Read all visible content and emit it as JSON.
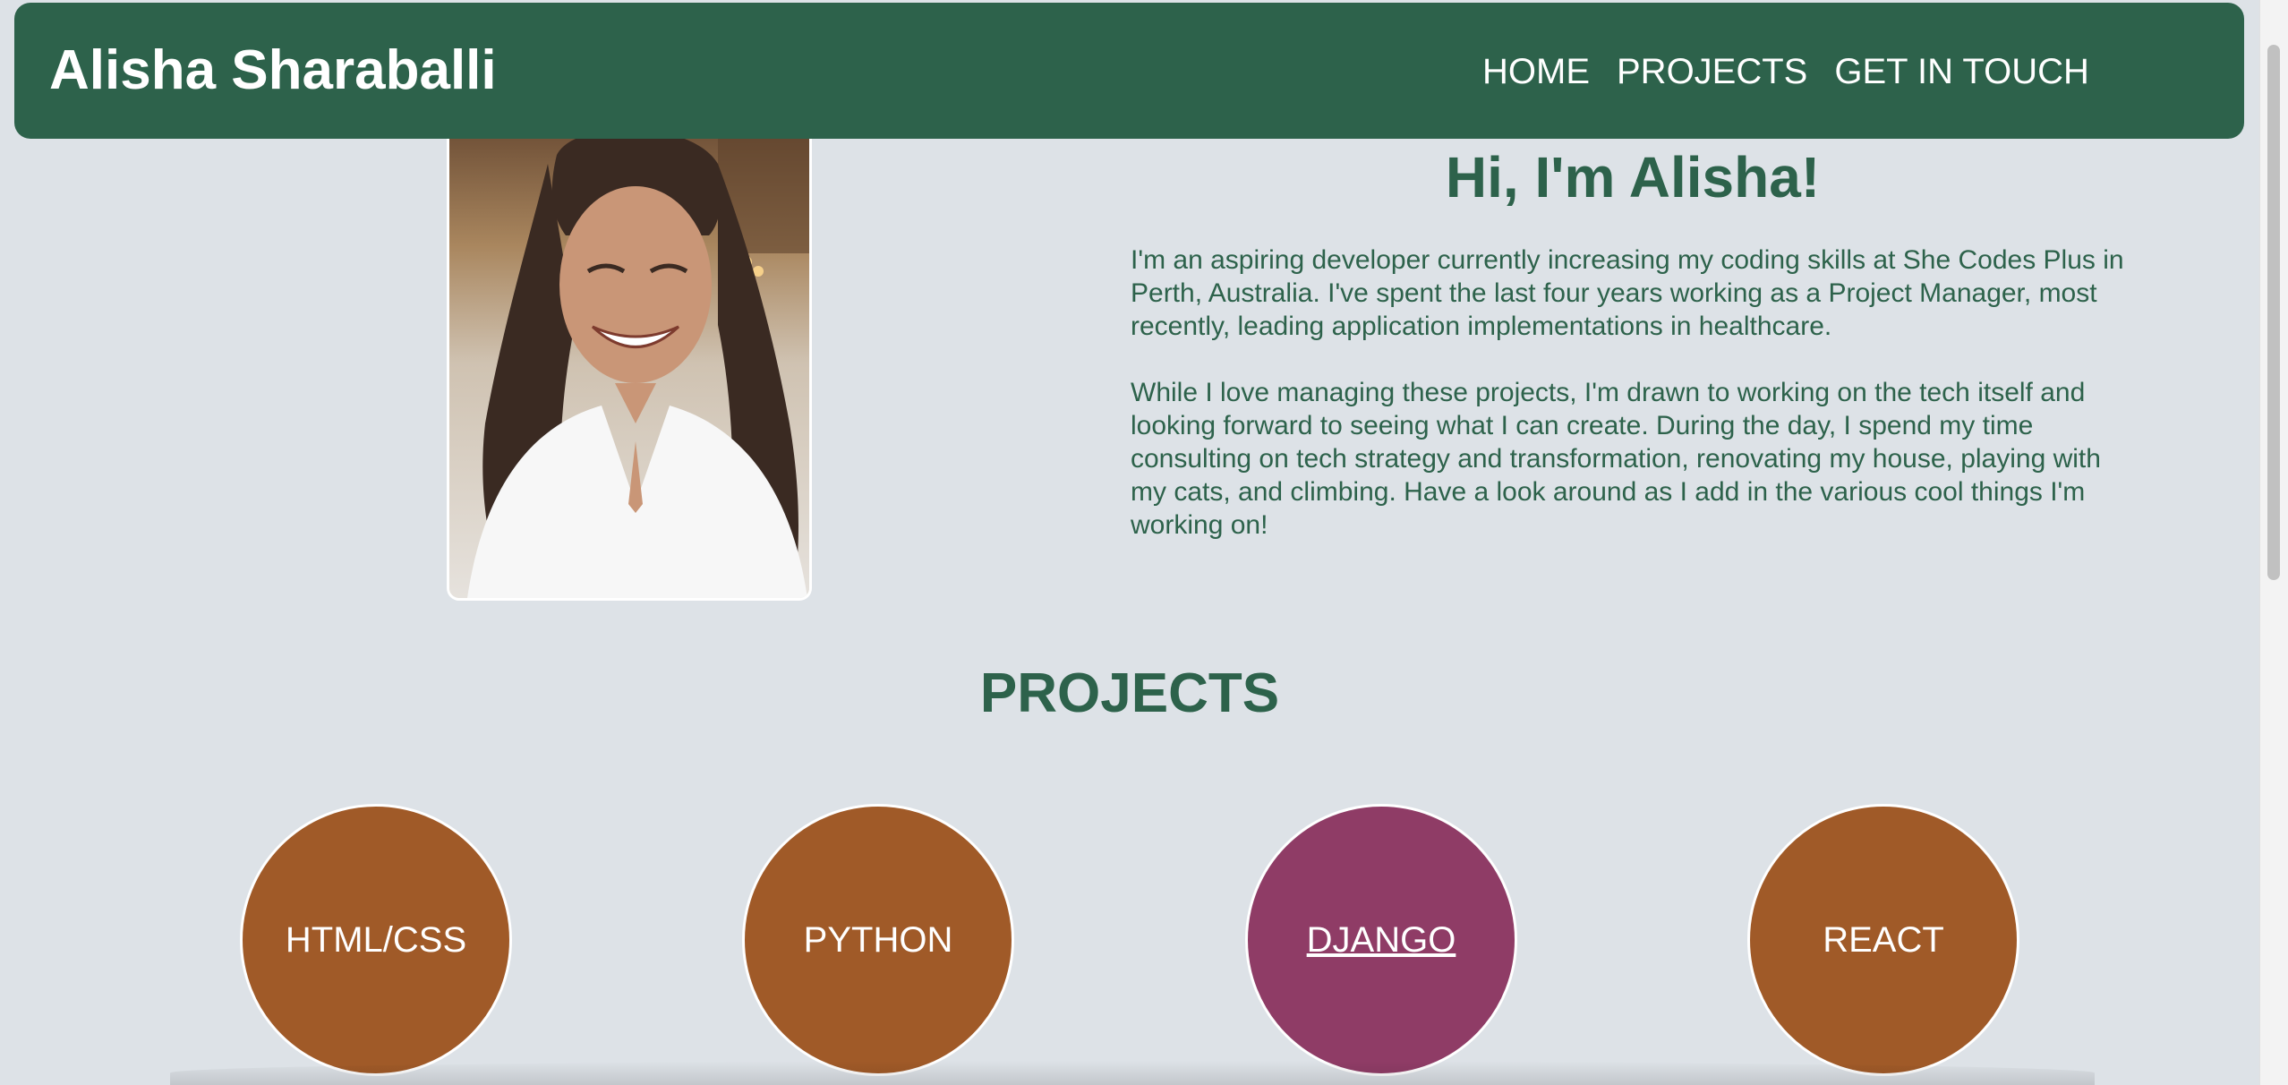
{
  "header": {
    "brand": "Alisha Sharaballi",
    "nav": [
      {
        "label": "HOME"
      },
      {
        "label": "PROJECTS"
      },
      {
        "label": "GET IN TOUCH"
      }
    ]
  },
  "intro": {
    "greeting": "Hi, I'm Alisha!",
    "paragraphs": [
      "I'm an aspiring developer currently increasing my coding skills at She Codes Plus in Perth, Australia. I've spent the last four years working as a Project Manager, most recently, leading application implementations in healthcare.",
      "While I love managing these projects, I'm drawn to working on the tech itself and looking forward to seeing what I can create. During the day, I spend my time consulting on tech strategy and transformation, renovating my house, playing with my cats, and climbing. Have a look around as I add in the various cool things I'm working on!"
    ]
  },
  "projects": {
    "title": "PROJECTS",
    "items": [
      {
        "label": "HTML/CSS"
      },
      {
        "label": "PYTHON"
      },
      {
        "label": "DJANGO"
      },
      {
        "label": "REACT"
      }
    ]
  },
  "colors": {
    "primary_green": "#2d624b",
    "project_orange": "#a05a28",
    "project_hover_purple": "#8f3c66",
    "page_background": "#dde2e7"
  }
}
